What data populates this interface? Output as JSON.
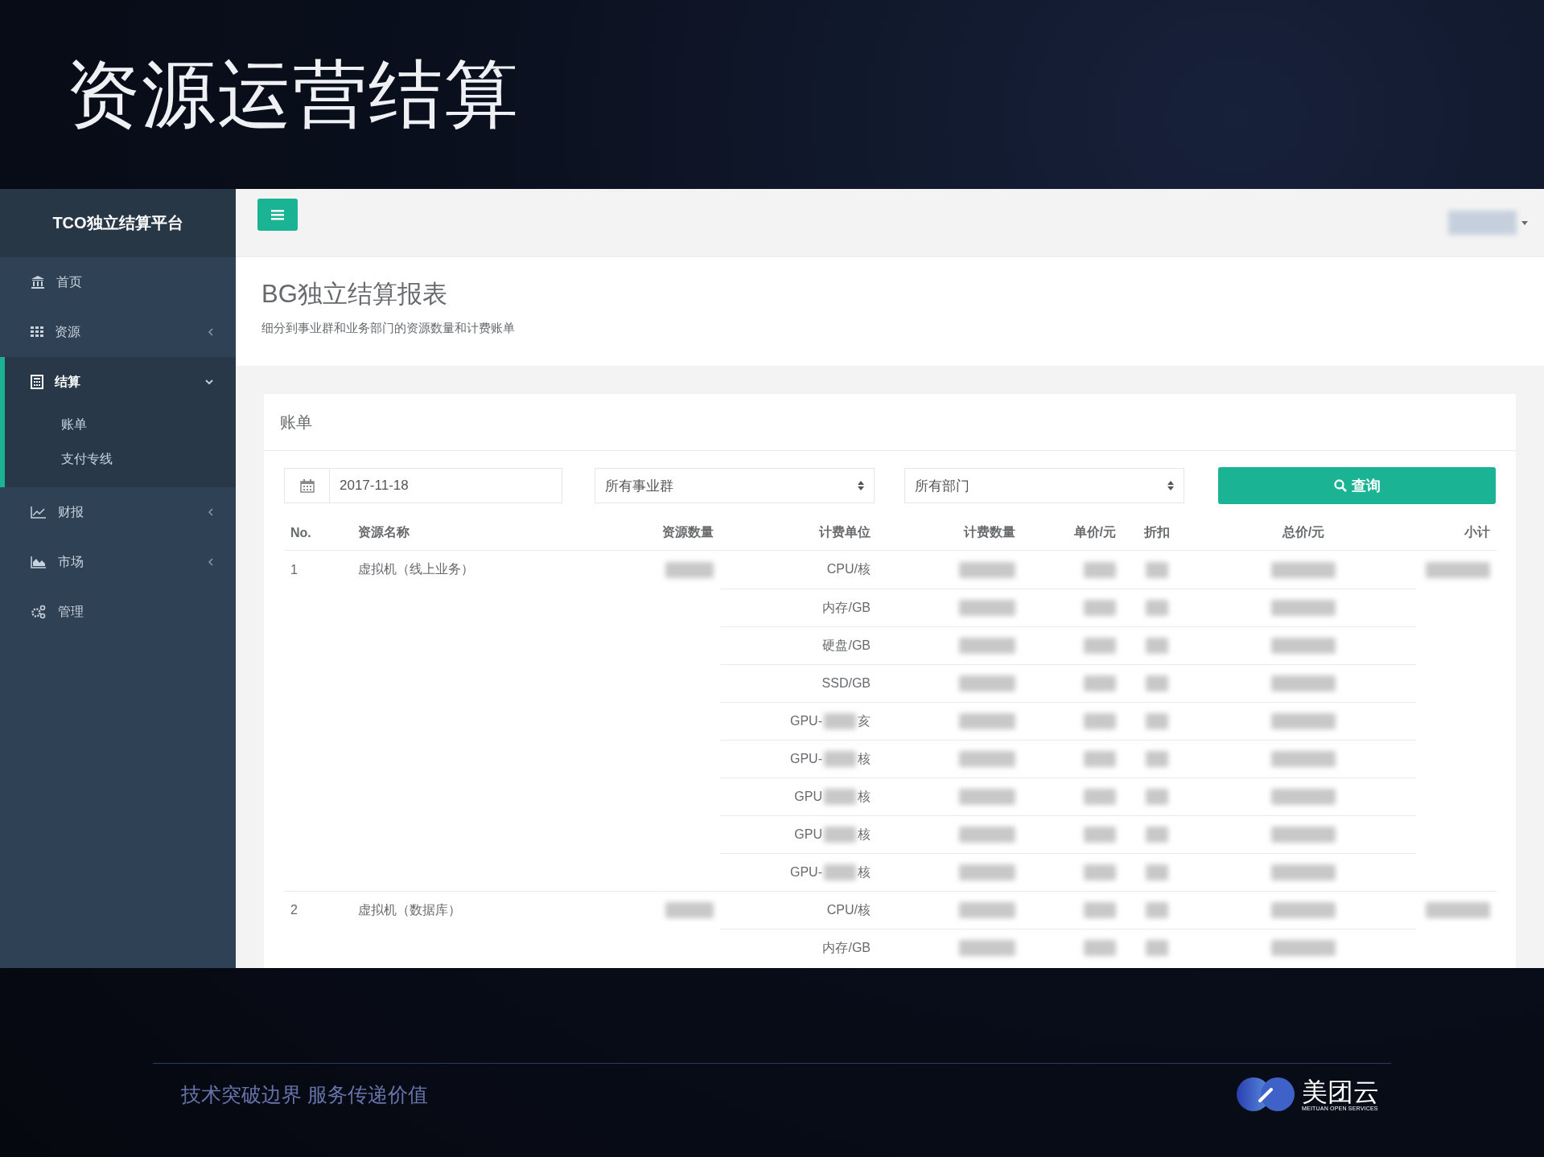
{
  "slide": {
    "title": "资源运营结算",
    "footer_slogan": "技术突破边界 服务传递价值",
    "logo": {
      "name": "美团云",
      "tagline": "MEITUAN OPEN SERVICES"
    }
  },
  "sidebar": {
    "brand": "TCO独立结算平台",
    "items": [
      {
        "label": "首页",
        "kind": "link",
        "selected": false
      },
      {
        "label": "资源",
        "kind": "group",
        "expanded": false,
        "selected": false
      },
      {
        "label": "结算",
        "kind": "group",
        "expanded": true,
        "selected": true,
        "children": [
          {
            "label": "账单"
          },
          {
            "label": "支付专线"
          }
        ]
      },
      {
        "label": "财报",
        "kind": "group",
        "expanded": false,
        "selected": false
      },
      {
        "label": "市场",
        "kind": "group",
        "expanded": false,
        "selected": false
      },
      {
        "label": "管理",
        "kind": "link",
        "selected": false
      }
    ]
  },
  "page": {
    "title": "BG独立结算报表",
    "subtitle": "细分到事业群和业务部门的资源数量和计费账单"
  },
  "card": {
    "title": "账单",
    "filters": {
      "date": "2017-11-18",
      "business_group": "所有事业群",
      "department": "所有部门",
      "search_button": "查询"
    },
    "table": {
      "columns": [
        "No.",
        "资源名称",
        "资源数量",
        "计费单位",
        "计费数量",
        "单价/元",
        "折扣",
        "总价/元",
        "小计"
      ],
      "groups": [
        {
          "no": "1",
          "name": "虚拟机（线上业务）",
          "units": [
            {
              "prefix": "CPU/核"
            },
            {
              "prefix": "内存/GB"
            },
            {
              "prefix": "硬盘/GB"
            },
            {
              "prefix": "SSD/GB"
            },
            {
              "prefix": "GPU-",
              "suffix": "亥"
            },
            {
              "prefix": "GPU-",
              "suffix": "核"
            },
            {
              "prefix": "GPU",
              "suffix": "核"
            },
            {
              "prefix": "GPU",
              "suffix": "核"
            },
            {
              "prefix": "GPU-",
              "suffix": "核"
            }
          ]
        },
        {
          "no": "2",
          "name": "虚拟机（数据库）",
          "units": [
            {
              "prefix": "CPU/核"
            },
            {
              "prefix": "内存/GB"
            }
          ]
        }
      ]
    }
  }
}
